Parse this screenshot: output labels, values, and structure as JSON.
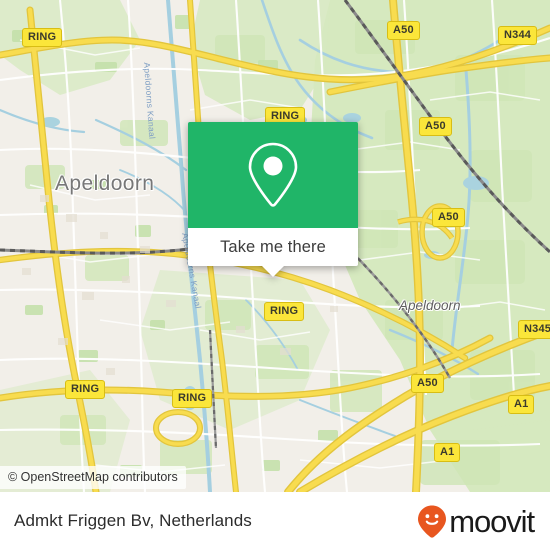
{
  "map": {
    "attribution": "© OpenStreetMap contributors",
    "labels": [
      {
        "name": "city-label-apeldoorn-major",
        "text": "Apeldoorn"
      },
      {
        "name": "city-label-apeldoorn-minor",
        "text": "Apeldoorn"
      },
      {
        "name": "water-label-apeldoorns-kanaal-north",
        "text": "Apeldoorns Kanaal"
      },
      {
        "name": "water-label-apeldoorns-kanaal-south",
        "text": "Apeldoorns Kanaal"
      }
    ],
    "shields": [
      {
        "name": "road-shield-ring-nw",
        "text": "RING"
      },
      {
        "name": "road-shield-a50-n",
        "text": "A50"
      },
      {
        "name": "road-shield-n344-ne",
        "text": "N344"
      },
      {
        "name": "road-shield-ring-n",
        "text": "RING"
      },
      {
        "name": "road-shield-a50-ne",
        "text": "A50"
      },
      {
        "name": "road-shield-a50-e",
        "text": "A50"
      },
      {
        "name": "road-shield-ring-c",
        "text": "RING"
      },
      {
        "name": "road-shield-n345-se",
        "text": "N345"
      },
      {
        "name": "road-shield-ring-sw",
        "text": "RING"
      },
      {
        "name": "road-shield-ring-s",
        "text": "RING"
      },
      {
        "name": "road-shield-a50-s",
        "text": "A50"
      },
      {
        "name": "road-shield-a1-e",
        "text": "A1"
      },
      {
        "name": "road-shield-a1-se",
        "text": "A1"
      }
    ],
    "colors": {
      "urban": "#f2efe9",
      "green": "#d6e9bf",
      "water": "#aad3df",
      "road_major": "#f7d74a",
      "road_minor": "#ffffff"
    }
  },
  "popup": {
    "cta_label": "Take me there",
    "accent_color": "#20b568",
    "pin_icon": "location-pin-icon"
  },
  "footer": {
    "place_title": "Admkt Friggen Bv, Netherlands",
    "brand_name": "moovit",
    "brand_icon": "moovit-smiley-pin-icon",
    "brand_color": "#e8561f"
  }
}
